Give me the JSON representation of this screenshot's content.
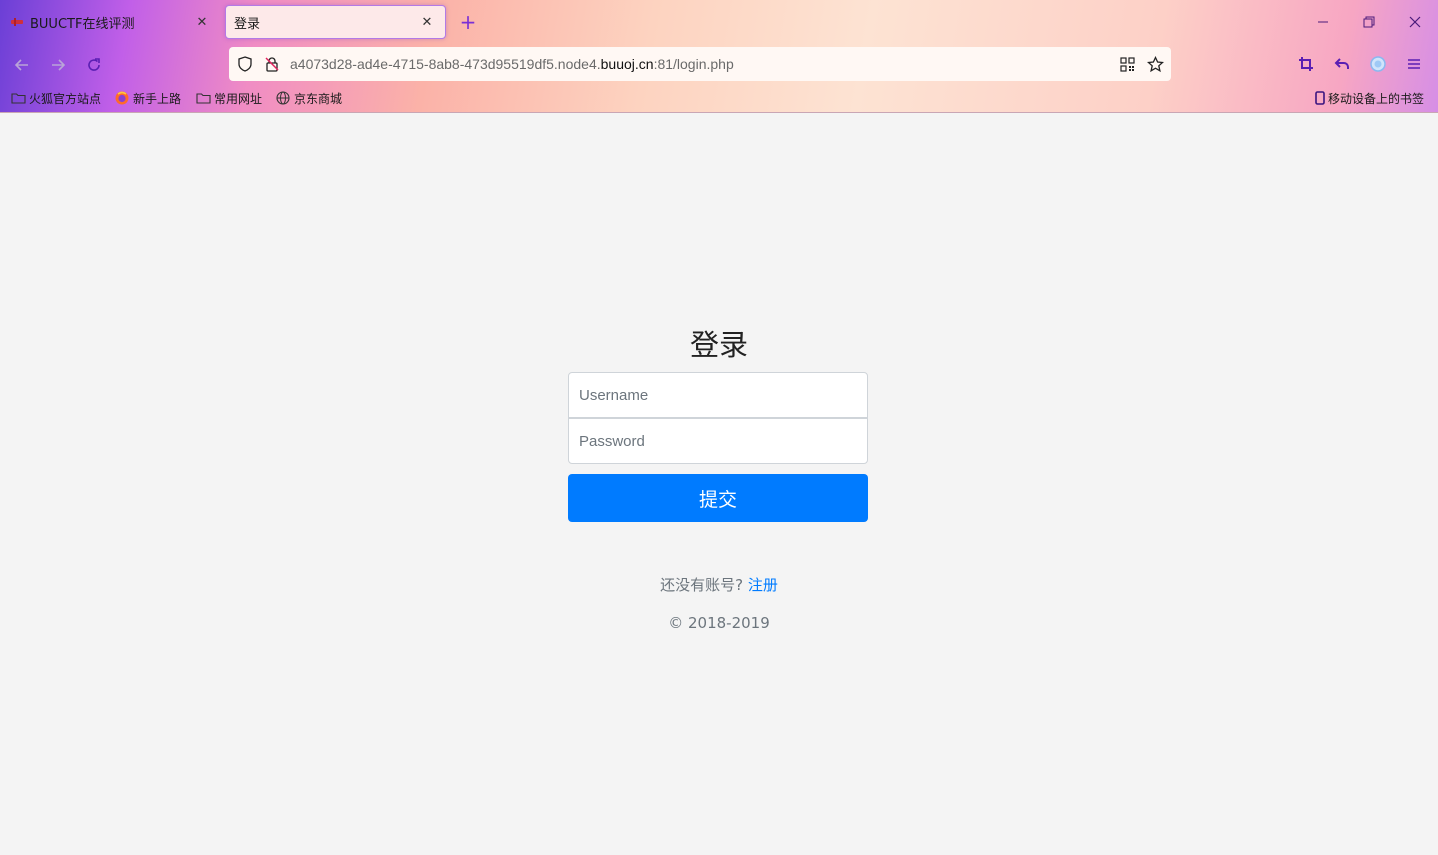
{
  "browser": {
    "tabs": [
      {
        "title": "BUUCTF在线评测",
        "active": false
      },
      {
        "title": "登录",
        "active": true
      }
    ],
    "url": {
      "prefix": "a4073d28-ad4e-4715-8ab8-473d95519df5.node4.",
      "host": "buuoj.cn",
      "suffix": ":81/login.php"
    },
    "bookmarks": [
      {
        "label": "火狐官方站点",
        "icon": "folder-icon"
      },
      {
        "label": "新手上路",
        "icon": "firefox-icon"
      },
      {
        "label": "常用网址",
        "icon": "folder-icon"
      },
      {
        "label": "京东商城",
        "icon": "globe-icon"
      }
    ],
    "mobile_bookmarks": "移动设备上的书签"
  },
  "login": {
    "title": "登录",
    "username_placeholder": "Username",
    "password_placeholder": "Password",
    "submit_label": "提交",
    "register_prompt": "还没有账号?",
    "register_link": "注册",
    "copyright": "© 2018-2019"
  },
  "colors": {
    "primary": "#007bff",
    "page_bg": "#f4f4f4",
    "muted_text": "#6c757d"
  }
}
